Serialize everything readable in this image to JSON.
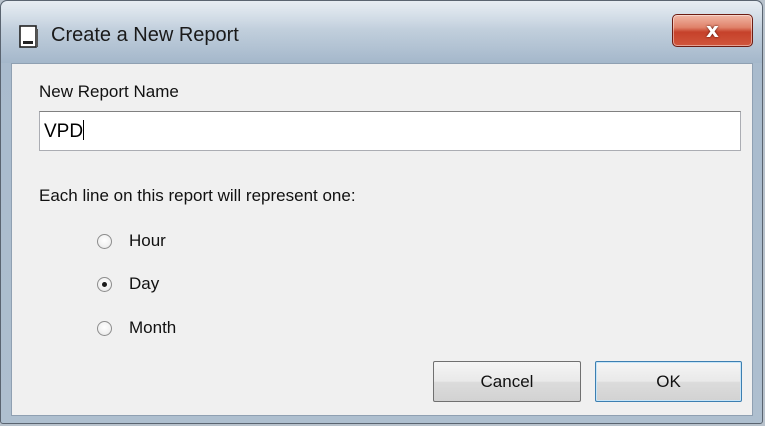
{
  "window": {
    "title": "Create a New Report",
    "close_label": "x"
  },
  "form": {
    "name_label": "New Report Name",
    "name_value": "VPD",
    "interval_label": "Each line on this report will represent one:",
    "options": [
      {
        "label": "Hour",
        "selected": false
      },
      {
        "label": "Day",
        "selected": true
      },
      {
        "label": "Month",
        "selected": false
      }
    ]
  },
  "buttons": {
    "cancel_label": "Cancel",
    "ok_label": "OK"
  },
  "colors": {
    "close_button": "#c6412a",
    "ok_focus_border": "#3c7fb1"
  },
  "icons": {
    "app": "report-icon",
    "close": "close-icon"
  }
}
